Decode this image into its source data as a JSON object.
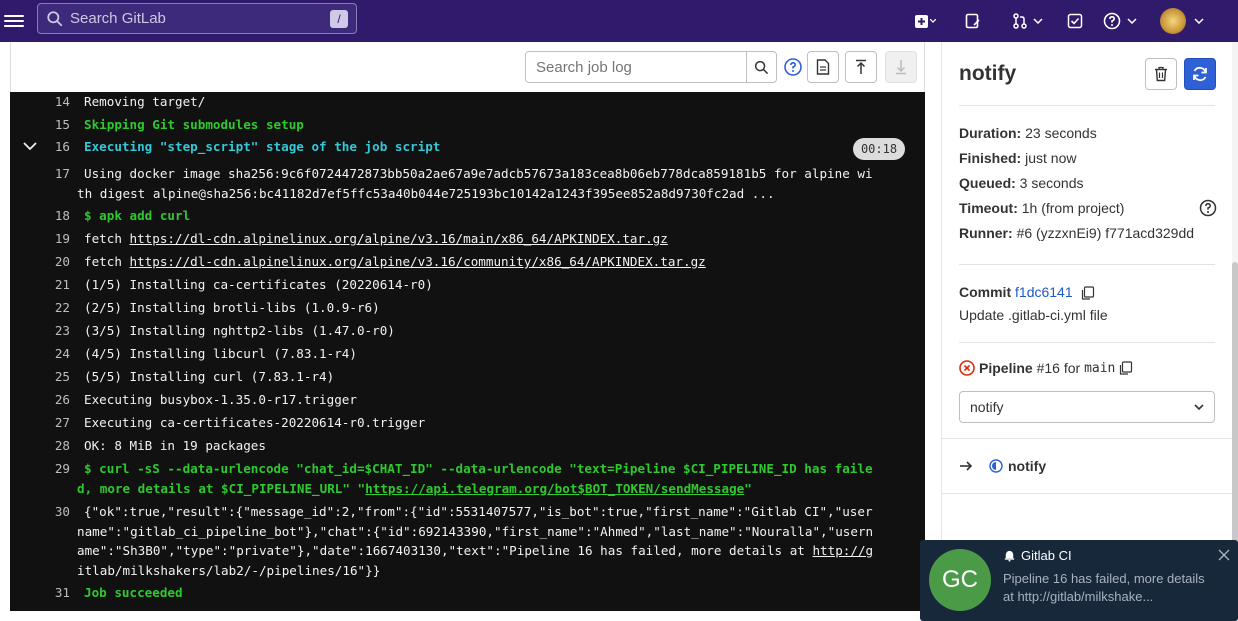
{
  "topbar": {
    "search_placeholder": "Search GitLab",
    "search_shortcut": "/"
  },
  "toolbar": {
    "log_search_placeholder": "Search job log"
  },
  "log": {
    "lines": [
      {
        "num": "14",
        "text": "Removing target/",
        "style": "plain"
      },
      {
        "num": "15",
        "text": "Skipping Git submodules setup",
        "style": "green"
      },
      {
        "num": "16",
        "text": "Executing \"step_script\" stage of the job script",
        "style": "cyan"
      },
      {
        "num": "17",
        "text": "Using docker image sha256:9c6f0724472873bb50a2ae67a9e7adcb57673a183cea8b06eb778dca859181b5 for alpine wi",
        "style": "plain"
      },
      {
        "num": "",
        "text": "th digest alpine@sha256:bc41182d7ef5ffc53a40b044e725193bc10142a1243f395ee852a8d9730fc2ad ...",
        "style": "plain"
      },
      {
        "num": "18",
        "text": "$ apk add curl",
        "style": "green"
      },
      {
        "num": "19",
        "text": "fetch https://dl-cdn.alpinelinux.org/alpine/v3.16/main/x86_64/APKINDEX.tar.gz",
        "style": "plain"
      },
      {
        "num": "20",
        "text": "fetch https://dl-cdn.alpinelinux.org/alpine/v3.16/community/x86_64/APKINDEX.tar.gz",
        "style": "plain"
      },
      {
        "num": "21",
        "text": "(1/5) Installing ca-certificates (20220614-r0)",
        "style": "plain"
      },
      {
        "num": "22",
        "text": "(2/5) Installing brotli-libs (1.0.9-r6)",
        "style": "plain"
      },
      {
        "num": "23",
        "text": "(3/5) Installing nghttp2-libs (1.47.0-r0)",
        "style": "plain"
      },
      {
        "num": "24",
        "text": "(4/5) Installing libcurl (7.83.1-r4)",
        "style": "plain"
      },
      {
        "num": "25",
        "text": "(5/5) Installing curl (7.83.1-r4)",
        "style": "plain"
      },
      {
        "num": "26",
        "text": "Executing busybox-1.35.0-r17.trigger",
        "style": "plain"
      },
      {
        "num": "27",
        "text": "Executing ca-certificates-20220614-r0.trigger",
        "style": "plain"
      },
      {
        "num": "28",
        "text": "OK: 8 MiB in 19 packages",
        "style": "plain"
      },
      {
        "num": "29",
        "text": "$ curl -sS --data-urlencode \"chat_id=$CHAT_ID\" --data-urlencode \"text=Pipeline $CI_PIPELINE_ID has faile",
        "style": "green"
      },
      {
        "num": "",
        "text": "d, more details at $CI_PIPELINE_URL\" \"https://api.telegram.org/bot$BOT_TOKEN/sendMessage\"",
        "style": "green"
      },
      {
        "num": "30",
        "text": "{\"ok\":true,\"result\":{\"message_id\":2,\"from\":{\"id\":5531407577,\"is_bot\":true,\"first_name\":\"Gitlab CI\",\"user",
        "style": "plain"
      },
      {
        "num": "",
        "text": "name\":\"gitlab_ci_pipeline_bot\"},\"chat\":{\"id\":692143390,\"first_name\":\"Ahmed\",\"last_name\":\"Nouralla\",\"usern",
        "style": "plain"
      },
      {
        "num": "",
        "text": "ame\":\"Sh3B0\",\"type\":\"private\"},\"date\":1667403130,\"text\":\"Pipeline 16 has failed, more details at http://g",
        "style": "plain"
      },
      {
        "num": "",
        "text": "itlab/milkshakers/lab2/-/pipelines/16\"}}",
        "style": "plain"
      },
      {
        "num": "31",
        "text": "Job succeeded",
        "style": "green"
      }
    ],
    "time_badge": "00:18"
  },
  "sidebar": {
    "job_name": "notify",
    "duration_label": "Duration:",
    "duration_value": "23 seconds",
    "finished_label": "Finished:",
    "finished_value": "just now",
    "queued_label": "Queued:",
    "queued_value": "3 seconds",
    "timeout_label": "Timeout:",
    "timeout_value": "1h (from project)",
    "runner_label": "Runner:",
    "runner_value": "#6 (yzzxnEi9) f771acd329dd",
    "commit_label": "Commit",
    "commit_sha": "f1dc6141",
    "commit_message": "Update .gitlab-ci.yml file",
    "pipeline_label": "Pipeline",
    "pipeline_id": "#16",
    "pipeline_for": "for",
    "pipeline_branch": "main",
    "stage_select": "notify",
    "job_list_item": "notify"
  },
  "notification": {
    "avatar_initials": "GC",
    "title": "Gitlab CI",
    "body": "Pipeline 16 has failed, more details at http://gitlab/milkshake..."
  },
  "colors": {
    "topbar": "#2f1a6b",
    "log_bg": "#111111",
    "green": "#2ec92e",
    "cyan": "#35c8d6",
    "primary": "#3060d6",
    "fail": "#dd2b0e"
  }
}
